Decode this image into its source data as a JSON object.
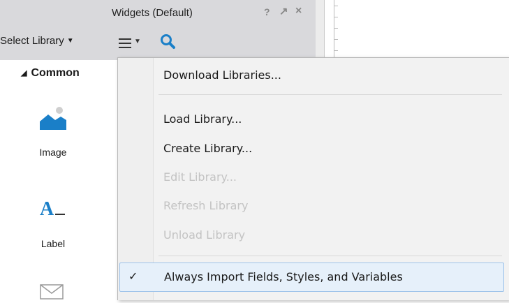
{
  "panel": {
    "title": "Widgets (Default)",
    "help_glyph": "?",
    "popout_glyph": "↗",
    "close_glyph": "×",
    "select_library_label": "Select Library",
    "section_common": "Common",
    "widgets": [
      {
        "label": "Image",
        "icon": "image-icon"
      },
      {
        "label": "Label",
        "icon": "label-icon"
      }
    ]
  },
  "menu": {
    "items": [
      {
        "label": "Download Libraries...",
        "enabled": true
      },
      {
        "label": "Load Library...",
        "enabled": true
      },
      {
        "label": "Create Library...",
        "enabled": true
      },
      {
        "label": "Edit Library...",
        "enabled": false
      },
      {
        "label": "Refresh Library",
        "enabled": false
      },
      {
        "label": "Unload Library",
        "enabled": false
      },
      {
        "label": "Always Import Fields, Styles, and Variables",
        "enabled": true,
        "checked": true
      }
    ],
    "check_glyph": "✓"
  },
  "colors": {
    "accent": "#1a7fc8",
    "header_bg": "#d9d9dc",
    "menu_bg": "#f2f2f2",
    "disabled_text": "#c3c3c3",
    "highlight_bg": "#e6f0fa"
  }
}
